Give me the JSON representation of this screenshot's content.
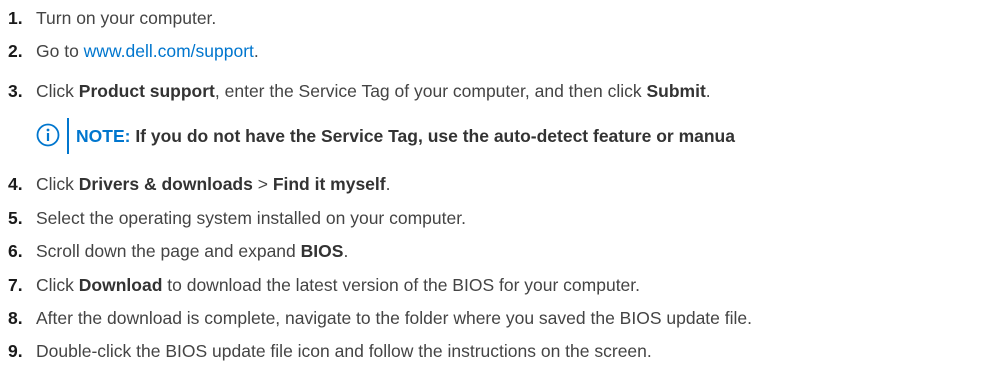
{
  "colors": {
    "text": "#444444",
    "bold_text": "#333333",
    "link": "#0076ce",
    "note_accent": "#0076ce"
  },
  "steps": [
    {
      "number": "1.",
      "text": "Turn on your computer."
    },
    {
      "number": "2.",
      "prefix": "Go to ",
      "link": "www.dell.com/support",
      "suffix": "."
    },
    {
      "number": "3.",
      "prefix": "Click ",
      "bold1": "Product support",
      "middle": ", enter the Service Tag of your computer, and then click ",
      "bold2": "Submit",
      "suffix": "."
    },
    {
      "number": "4.",
      "prefix": "Click ",
      "bold1": "Drivers & downloads",
      "middle": " > ",
      "bold2": "Find it myself",
      "suffix": "."
    },
    {
      "number": "5.",
      "text": "Select the operating system installed on your computer."
    },
    {
      "number": "6.",
      "prefix": "Scroll down the page and expand ",
      "bold1": "BIOS",
      "suffix": "."
    },
    {
      "number": "7.",
      "prefix": "Click ",
      "bold1": "Download",
      "suffix": " to download the latest version of the BIOS for your computer."
    },
    {
      "number": "8.",
      "text": "After the download is complete, navigate to the folder where you saved the BIOS update file."
    },
    {
      "number": "9.",
      "text": "Double-click the BIOS update file icon and follow the instructions on the screen."
    }
  ],
  "note": {
    "icon": "info-icon",
    "label": "NOTE:",
    "text": " If you do not have the Service Tag, use the auto-detect feature or manua"
  }
}
